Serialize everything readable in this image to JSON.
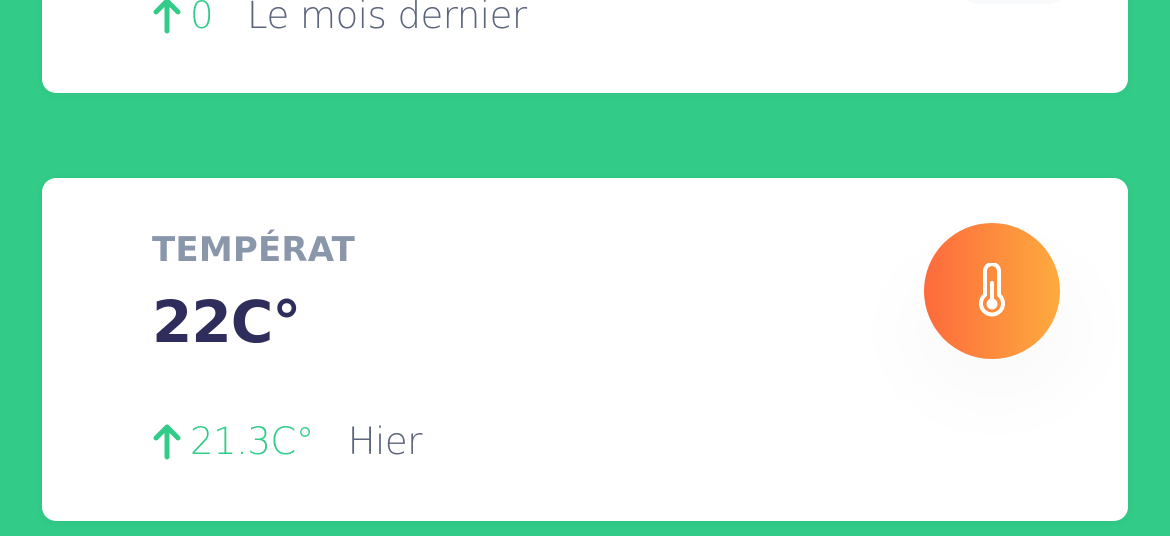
{
  "previous_card": {
    "change_value": "0",
    "change_caption": "Le mois dernier"
  },
  "temperature_card": {
    "title": "TEMPÉRAT",
    "value": "22C°",
    "change_value": "21.3C°",
    "change_caption": "Hier",
    "icon": "thermometer-icon"
  },
  "colors": {
    "background": "#32cb88",
    "positive": "#32cb88",
    "value_text": "#2f2d5c",
    "title_text": "#8a97ab",
    "icon_gradient_start": "#fd6a3c",
    "icon_gradient_end": "#fdab3e"
  }
}
